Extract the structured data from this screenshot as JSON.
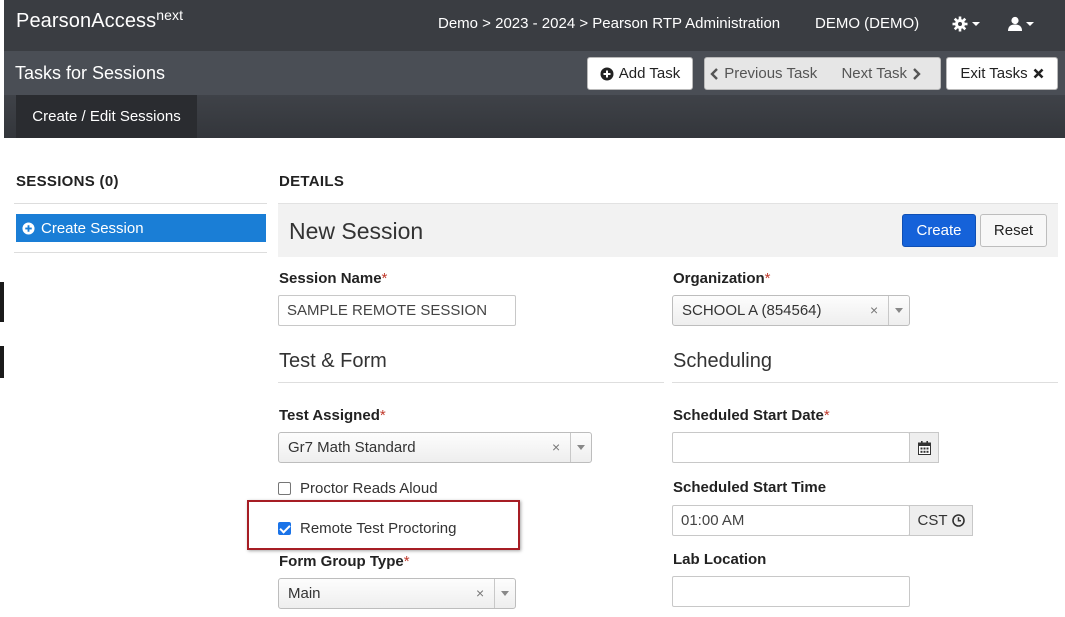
{
  "app": {
    "brand": "PearsonAccess",
    "brand_sup": "next",
    "breadcrumb": "Demo > 2023 - 2024 > Pearson RTP Administration",
    "org_selector": "DEMO (DEMO)",
    "settings_icon": "gear-icon",
    "user_icon": "user-icon"
  },
  "taskbar": {
    "title": "Tasks for Sessions",
    "add_task": "Add Task",
    "previous_task": "Previous Task",
    "next_task": "Next Task",
    "exit_tasks": "Exit Tasks"
  },
  "tabs": [
    {
      "label": "Create / Edit Sessions",
      "active": true
    }
  ],
  "sidebar": {
    "heading": "SESSIONS (0)",
    "create_session": "Create Session"
  },
  "details": {
    "heading": "DETAILS",
    "title": "New Session",
    "create_button": "Create",
    "reset_button": "Reset"
  },
  "form": {
    "session_name": {
      "label": "Session Name",
      "value": "SAMPLE REMOTE SESSION"
    },
    "organization": {
      "label": "Organization",
      "value": "SCHOOL A (854564)"
    },
    "test_form_heading": "Test & Form",
    "scheduling_heading": "Scheduling",
    "test_assigned": {
      "label": "Test Assigned",
      "value": "Gr7 Math Standard"
    },
    "scheduled_start_date": {
      "label": "Scheduled Start Date",
      "value": ""
    },
    "proctor_reads_aloud": {
      "label": "Proctor Reads Aloud",
      "checked": false
    },
    "remote_test_proctoring": {
      "label": "Remote Test Proctoring",
      "checked": true
    },
    "scheduled_start_time": {
      "label": "Scheduled Start Time",
      "value": "01:00 AM",
      "timezone": "CST"
    },
    "form_group_type": {
      "label": "Form Group Type",
      "value": "Main"
    },
    "lab_location": {
      "label": "Lab Location",
      "value": ""
    },
    "required_marker": "*",
    "clear_glyph": "×"
  },
  "colors": {
    "nav_bg": "#3a3d42",
    "accent": "#1a7ed6",
    "primary_button": "#1562d9",
    "highlight_border": "#a61d24"
  }
}
